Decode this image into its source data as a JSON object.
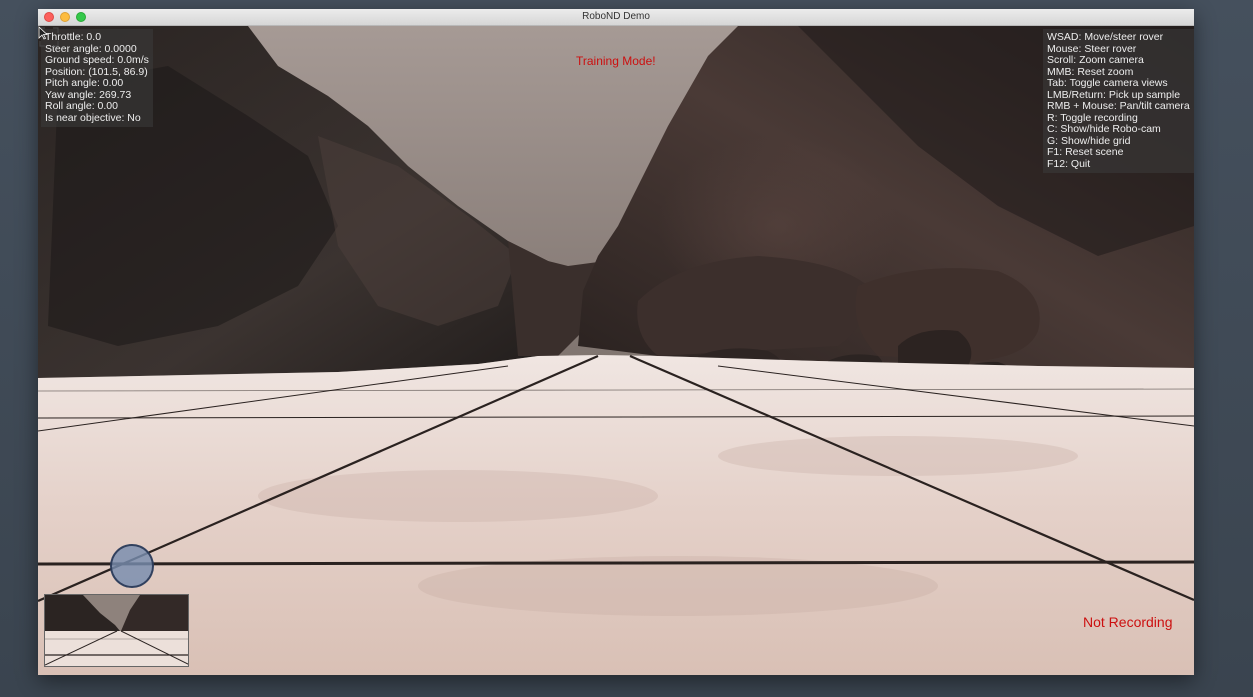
{
  "window": {
    "title": "RoboND Demo"
  },
  "telemetry": {
    "lines": [
      "Throttle: 0.0",
      "Steer angle: 0.0000",
      "Ground speed: 0.0m/s",
      "Position: (101.5, 86.9)",
      "Pitch angle: 0.00",
      "Yaw angle: 269.73",
      "Roll angle: 0.00",
      "Is near objective: No"
    ]
  },
  "controls_help": {
    "lines": [
      "WSAD: Move/steer rover",
      "Mouse: Steer rover",
      "Scroll: Zoom camera",
      "MMB: Reset zoom",
      "Tab: Toggle camera views",
      "LMB/Return: Pick up sample",
      "RMB + Mouse: Pan/tilt camera",
      "R: Toggle recording",
      "C: Show/hide Robo-cam",
      "G: Show/hide grid",
      "F1: Reset scene",
      "F12: Quit"
    ]
  },
  "status": {
    "mode": "Training Mode!",
    "recording": "Not Recording",
    "alert_color": "#cc1010"
  },
  "icons": {
    "reticle": "reticle-icon",
    "joystick": "virtual-joystick",
    "cursor": "mouse-pointer-icon"
  }
}
